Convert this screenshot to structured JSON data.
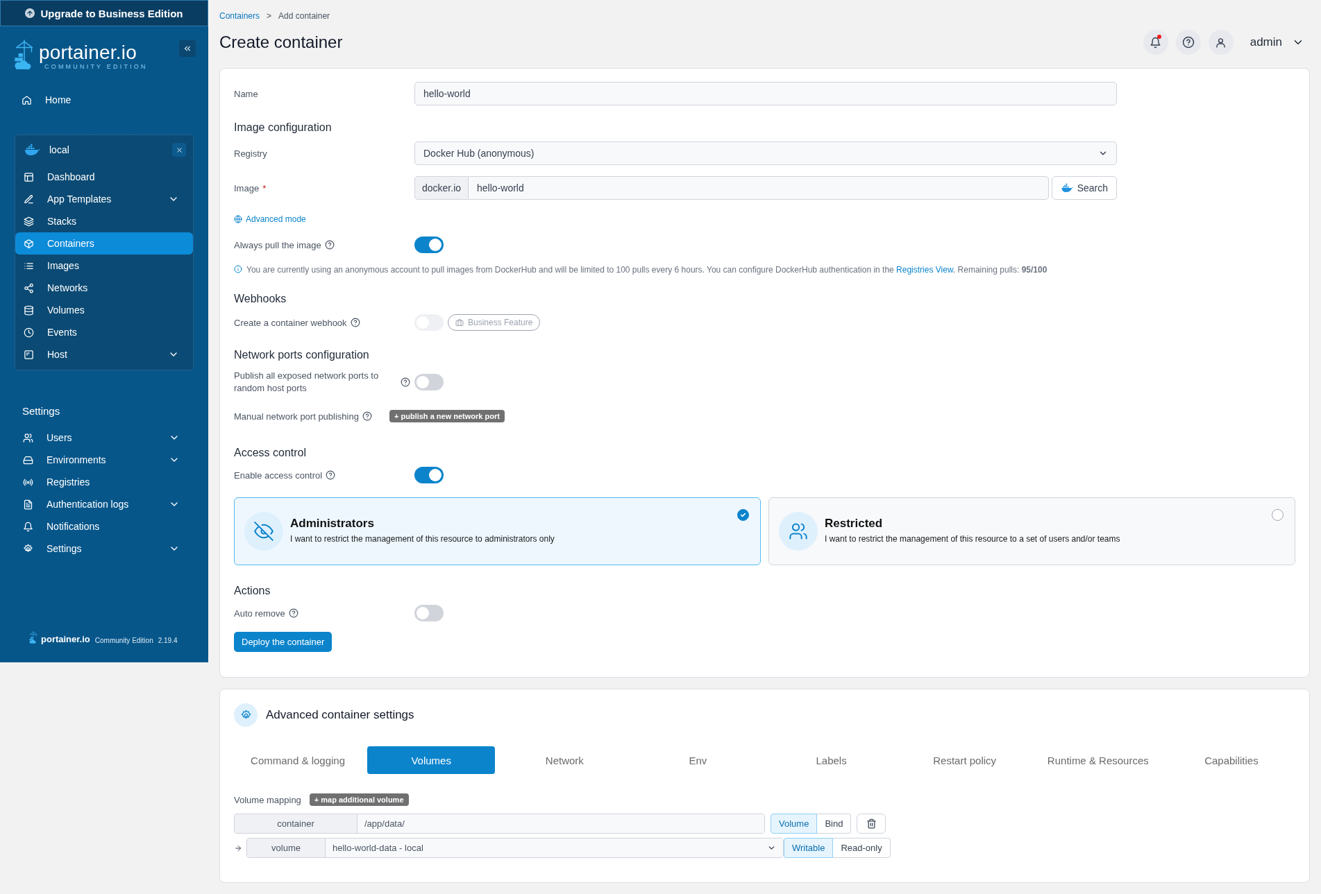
{
  "sidebar": {
    "upgrade_banner": "Upgrade to Business Edition",
    "logo": {
      "name": "portainer.io",
      "edition": "COMMUNITY EDITION"
    },
    "home": {
      "label": "Home",
      "selected": false
    },
    "environment": {
      "name": "local",
      "items": [
        {
          "label": "Dashboard",
          "selected": false,
          "has_submenu": false
        },
        {
          "label": "App Templates",
          "selected": false,
          "has_submenu": true
        },
        {
          "label": "Stacks",
          "selected": false,
          "has_submenu": false
        },
        {
          "label": "Containers",
          "selected": true,
          "has_submenu": false
        },
        {
          "label": "Images",
          "selected": false,
          "has_submenu": false
        },
        {
          "label": "Networks",
          "selected": false,
          "has_submenu": false
        },
        {
          "label": "Volumes",
          "selected": false,
          "has_submenu": false
        },
        {
          "label": "Events",
          "selected": false,
          "has_submenu": false
        },
        {
          "label": "Host",
          "selected": false,
          "has_submenu": true
        }
      ]
    },
    "settings_heading": "Settings",
    "settings_items": [
      {
        "label": "Users",
        "selected": false,
        "has_submenu": true
      },
      {
        "label": "Environments",
        "selected": false,
        "has_submenu": true
      },
      {
        "label": "Registries",
        "selected": false,
        "has_submenu": false
      },
      {
        "label": "Authentication logs",
        "selected": false,
        "has_submenu": true
      },
      {
        "label": "Notifications",
        "selected": false,
        "has_submenu": false
      },
      {
        "label": "Settings",
        "selected": false,
        "has_submenu": true
      }
    ],
    "footer": {
      "name": "portainer.io",
      "edition": "Community Edition",
      "version": "2.19.4"
    }
  },
  "breadcrumb": {
    "parent": "Containers",
    "separator": ">",
    "current": "Add container"
  },
  "page_title": "Create container",
  "header": {
    "unread_notifications": true,
    "user": "admin"
  },
  "form": {
    "name": {
      "label": "Name",
      "value": "hello-world"
    },
    "image_configuration": {
      "heading": "Image configuration",
      "registry": {
        "label": "Registry",
        "value": "Docker Hub (anonymous)"
      },
      "image": {
        "label": "Image",
        "required_mark": "*",
        "prefix": "docker.io",
        "value": "hello-world",
        "search_button": "Search"
      },
      "advanced_mode": "Advanced mode",
      "always_pull": {
        "label": "Always pull the image",
        "on": true
      },
      "info": {
        "text": "You are currently using an anonymous account to pull images from DockerHub and will be limited to 100 pulls every 6 hours. You can configure DockerHub authentication in the",
        "link": "Registries View",
        "after": ". Remaining pulls: **95/100**"
      }
    },
    "webhooks": {
      "heading": "Webhooks",
      "create_webhook": {
        "label": "Create a container webhook",
        "on": false,
        "disabled": true
      },
      "badge": "Business Feature"
    },
    "network_ports": {
      "heading": "Network ports configuration",
      "publish_all": {
        "label": "Publish all exposed network ports to random host ports",
        "on": false
      },
      "manual": {
        "label": "Manual network port publishing",
        "button": "+ publish a new network port"
      }
    },
    "access_control": {
      "heading": "Access control",
      "enable": {
        "label": "Enable access control",
        "on": true
      },
      "options": [
        {
          "title": "Administrators",
          "description": "I want to restrict the management of this resource to administrators only",
          "selected": true
        },
        {
          "title": "Restricted",
          "description": "I want to restrict the management of this resource to a set of users and/or teams",
          "selected": false
        }
      ]
    },
    "actions": {
      "heading": "Actions",
      "auto_remove": {
        "label": "Auto remove",
        "on": false
      },
      "deploy_button": "Deploy the container"
    }
  },
  "advanced": {
    "title": "Advanced container settings",
    "tabs": [
      {
        "label": "Command & logging",
        "selected": false
      },
      {
        "label": "Volumes",
        "selected": true
      },
      {
        "label": "Network",
        "selected": false
      },
      {
        "label": "Env",
        "selected": false
      },
      {
        "label": "Labels",
        "selected": false
      },
      {
        "label": "Restart policy",
        "selected": false
      },
      {
        "label": "Runtime & Resources",
        "selected": false
      },
      {
        "label": "Capabilities",
        "selected": false
      }
    ],
    "volume_mapping": {
      "label": "Volume mapping",
      "add_button": "+ map additional volume",
      "container_label": "container",
      "container_path": "/app/data/",
      "type_options": [
        {
          "label": "Volume",
          "selected": true
        },
        {
          "label": "Bind",
          "selected": false
        }
      ],
      "volume_label": "volume",
      "volume_value": "hello-world-data - local",
      "mode_options": [
        {
          "label": "Writable",
          "selected": true
        },
        {
          "label": "Read-only",
          "selected": false
        }
      ]
    }
  }
}
